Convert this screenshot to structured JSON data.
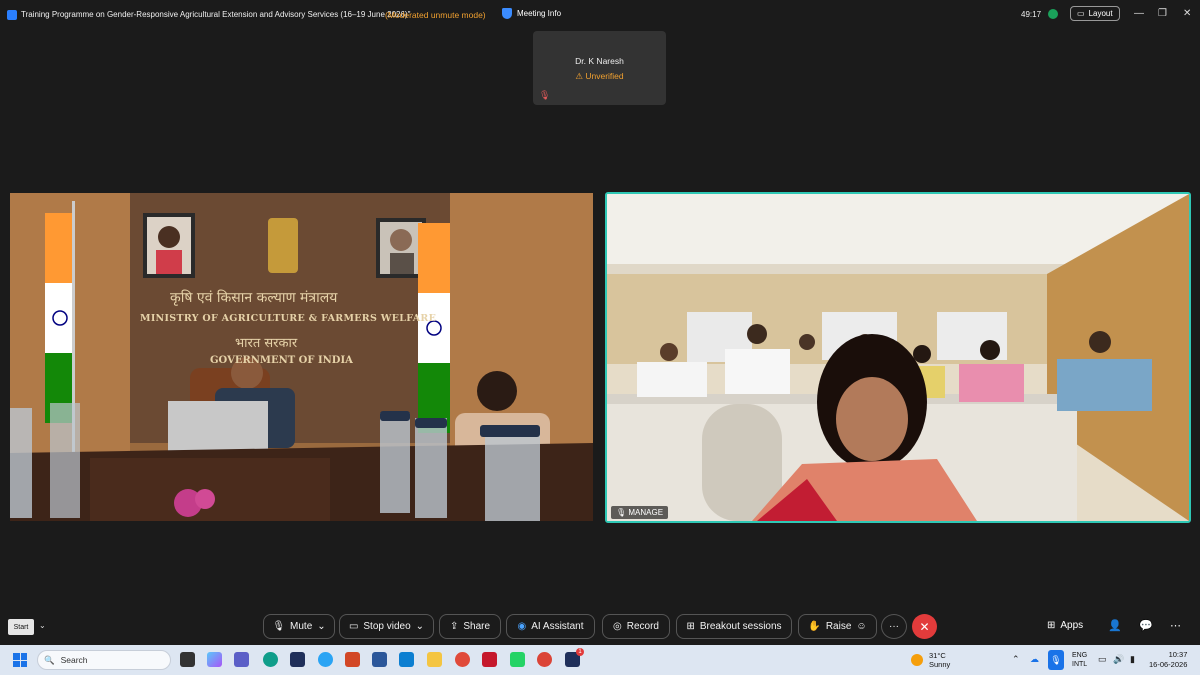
{
  "window": {
    "title": "Training Programme on Gender-Responsive Agricultural Extension and Advisory Services (16–19 June 2026)\"",
    "mode": "(Moderated unmute mode)",
    "meeting_info": "Meeting Info",
    "timer": "49:17",
    "layout": "Layout"
  },
  "participant": {
    "name": "Dr. K Naresh",
    "status": "Unverified"
  },
  "video_left": {
    "banner_hindi": "कृषि एवं किसान कल्याण मंत्रालय",
    "banner_english": "MINISTRY OF AGRICULTURE & FARMERS WELFARE",
    "gov_hindi": "भारत सरकार",
    "gov_english": "GOVERNMENT OF INDIA"
  },
  "video_right": {
    "label": "MANAGE"
  },
  "controls": {
    "start": "Start",
    "mute": "Mute",
    "stop_video": "Stop video",
    "share": "Share",
    "ai_assistant": "AI Assistant",
    "record": "Record",
    "breakout": "Breakout sessions",
    "raise": "Raise",
    "apps": "Apps"
  },
  "taskbar": {
    "search": "Search",
    "weather_temp": "31°C",
    "weather_desc": "Sunny",
    "lang1": "ENG",
    "lang2": "INTL",
    "time": "10:37",
    "date": "16-06-2026",
    "badge": "1"
  },
  "colors": {
    "accent": "#2fc8b5",
    "warning": "#f0a030",
    "end": "#e23b3b"
  }
}
